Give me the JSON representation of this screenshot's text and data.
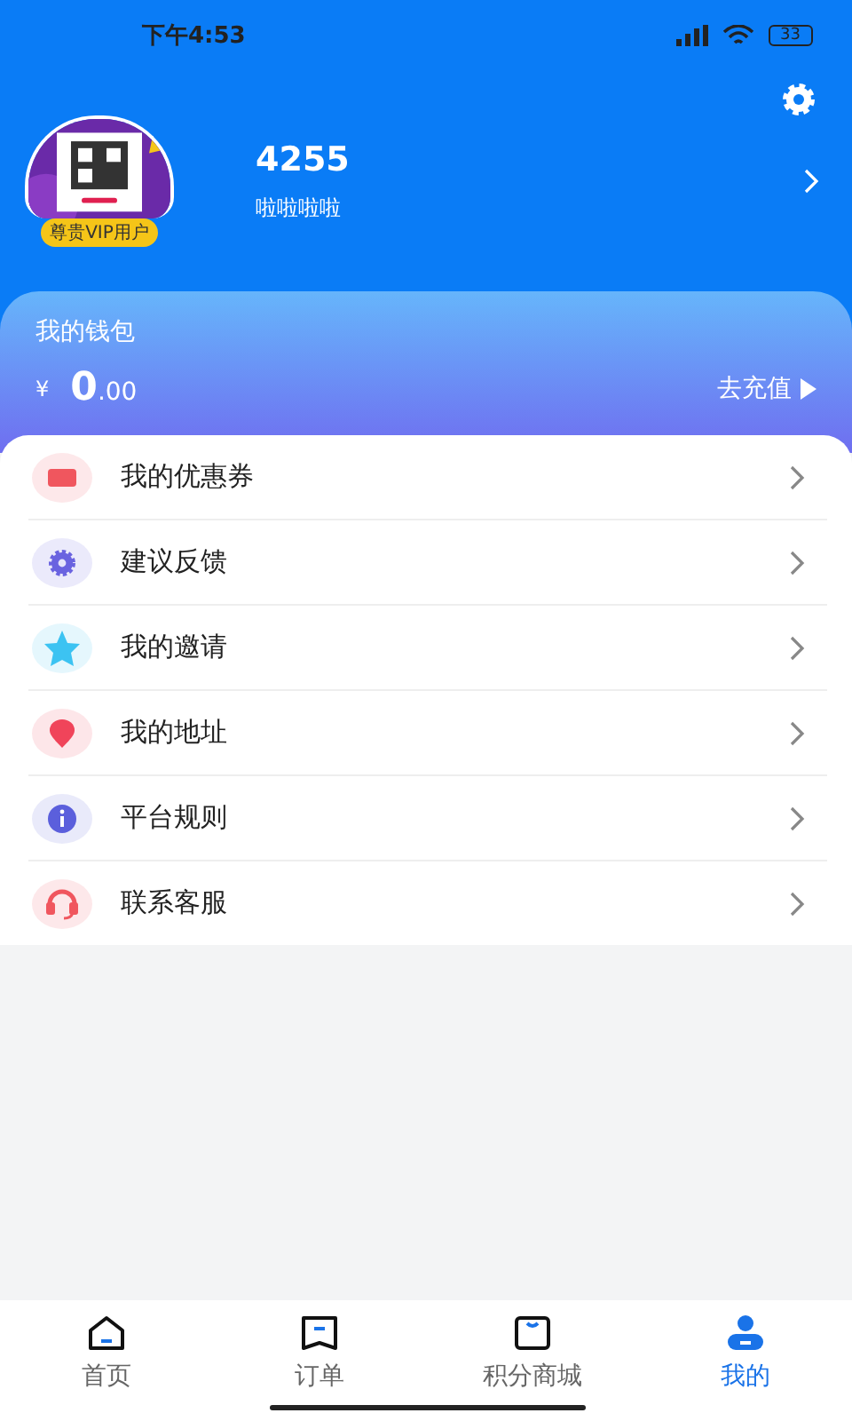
{
  "status_bar": {
    "time": "下午4:53",
    "battery": "33"
  },
  "profile": {
    "badge": "尊贵VIP用户",
    "name": "4255",
    "subtitle": "啦啦啦啦"
  },
  "wallet": {
    "title": "我的钱包",
    "currency": "¥",
    "amount": "0",
    "decimals": ".00",
    "action": "去充值"
  },
  "menu": [
    {
      "label": "我的优惠券",
      "kind": "coupon",
      "color": "#f0565e"
    },
    {
      "label": "建议反馈",
      "kind": "gear",
      "color": "#6a63e0"
    },
    {
      "label": "我的邀请",
      "kind": "star",
      "color": "#3cc3f2"
    },
    {
      "label": "我的地址",
      "kind": "location",
      "color": "#f0445a"
    },
    {
      "label": "平台规则",
      "kind": "info",
      "color": "#5b5fdc"
    },
    {
      "label": "联系客服",
      "kind": "headset",
      "color": "#f0565e"
    }
  ],
  "tabs": [
    {
      "label": "首页",
      "kind": "home",
      "selected": false
    },
    {
      "label": "订单",
      "kind": "order",
      "selected": false
    },
    {
      "label": "积分商城",
      "kind": "shop",
      "selected": false
    },
    {
      "label": "我的",
      "kind": "user",
      "selected": true
    }
  ]
}
